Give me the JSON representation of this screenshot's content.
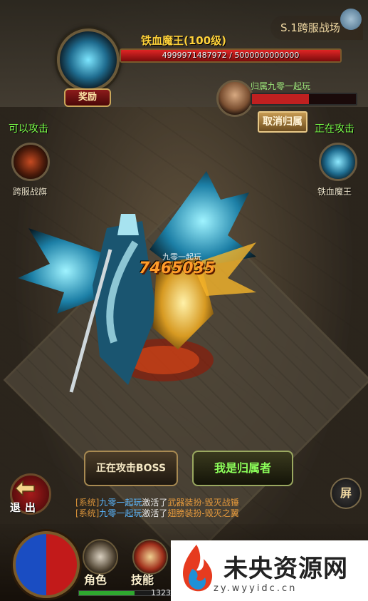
{
  "boss": {
    "name": "铁血魔王(100级)",
    "hp_text": "4999971487972 / 5000000000000",
    "hp_fraction": 0.99999,
    "reward_label": "奖励"
  },
  "server": {
    "label": "S.1跨服战场"
  },
  "owner": {
    "name": "归属九零一起玩",
    "hp_fraction": 0.55,
    "cancel_label": "取消归属"
  },
  "left_side": {
    "status": "可以攻击",
    "caption": "跨服战旗"
  },
  "right_side": {
    "status": "正在攻击",
    "caption": "铁血魔王"
  },
  "combat": {
    "damage": "7465035",
    "attacker": "九零一起玩"
  },
  "buttons": {
    "attacking_boss": "正在攻击BOSS",
    "i_am_owner": "我是归属者",
    "exit": "退出",
    "screen": "屏"
  },
  "system_log": [
    {
      "tag": "[系统]",
      "player": "九零一起玩",
      "verb": "激活了",
      "item": "武器装扮-毁灭战锤"
    },
    {
      "tag": "[系统]",
      "player": "九零一起玩",
      "verb": "激活了",
      "item": "翅膀装扮-毁灭之翼"
    }
  ],
  "bottom_menu": {
    "role": "角色",
    "skill": "技能",
    "level_text": "1323",
    "exp_fraction": 0.6
  },
  "watermark": {
    "title": "未央资源网",
    "url": "zy.wyyidc.cn"
  },
  "colors": {
    "boss_name": "#ffd23a",
    "hp_red": "#e02525",
    "green_status": "#7cff4a",
    "owner_green": "#8cff5a",
    "log_player_blue": "#5ab7ff",
    "log_item_orange": "#e69a3c"
  },
  "icons": [
    "boss-portrait-icon",
    "owner-avatar-icon",
    "war-flag-icon",
    "boss-target-icon",
    "exit-arrow-icon",
    "hp-mp-orb-icon",
    "role-helmet-icon",
    "skill-scroll-icon",
    "server-globe-icon",
    "watermark-flame-logo"
  ]
}
